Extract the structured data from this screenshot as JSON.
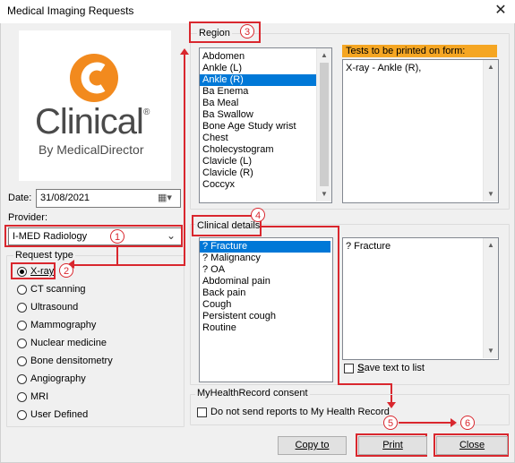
{
  "window": {
    "title": "Medical Imaging Requests"
  },
  "logo": {
    "word": "Clinical",
    "trademark": "®",
    "byline": "By MedicalDirector",
    "accent": "#f28a1e"
  },
  "date": {
    "label": "Date:",
    "value": "31/08/2021"
  },
  "provider": {
    "label": "Provider:",
    "value": "I-MED Radiology"
  },
  "request_type": {
    "label": "Request type",
    "options": [
      "X-ray",
      "CT scanning",
      "Ultrasound",
      "Mammography",
      "Nuclear medicine",
      "Bone densitometry",
      "Angiography",
      "MRI",
      "User Defined"
    ],
    "selected": "X-ray"
  },
  "region": {
    "label": "Region",
    "items": [
      "Abdomen",
      "Ankle (L)",
      "Ankle (R)",
      "Ba Enema",
      "Ba Meal",
      "Ba Swallow",
      "Bone Age Study wrist",
      "Chest",
      "Cholecystogram",
      "Clavicle (L)",
      "Clavicle (R)",
      "Coccyx"
    ],
    "selected": "Ankle (R)"
  },
  "tests": {
    "label": "Tests to be printed on form:",
    "value": "X-ray - Ankle (R),"
  },
  "clinical": {
    "label": "Clinical details",
    "items": [
      "? Fracture",
      "? Malignancy",
      "? OA",
      "Abdominal pain",
      "Back pain",
      "Cough",
      "Persistent cough",
      "Routine"
    ],
    "selected": "? Fracture",
    "text_value": "? Fracture",
    "save_label": "Save text to list"
  },
  "mhr": {
    "label": "MyHealthRecord consent",
    "checkbox_label": "Do not send reports to My Health Record"
  },
  "buttons": {
    "copy": "Copy to",
    "print": "Print",
    "close": "Close"
  },
  "annotations": [
    "1",
    "2",
    "3",
    "4",
    "5",
    "6"
  ],
  "colors": {
    "annotation": "#d9272e",
    "selection": "#0078d7",
    "tests_header": "#f5a623"
  }
}
